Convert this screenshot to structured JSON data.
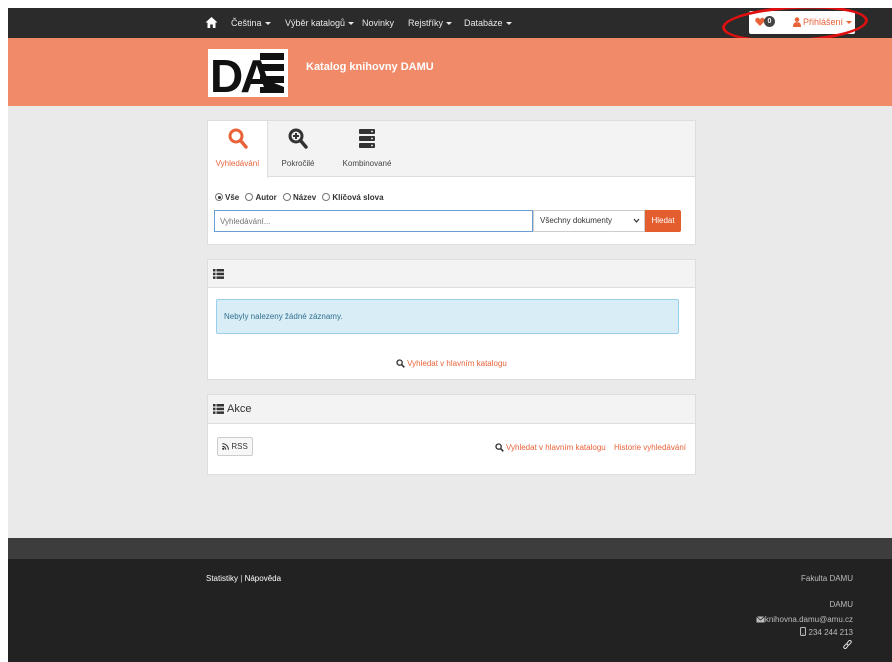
{
  "nav": {
    "items": [
      "Čeština",
      "Výběr katalogů",
      "Novinky",
      "Rejstříky",
      "Databáze"
    ],
    "has_caret": [
      true,
      true,
      false,
      true,
      true
    ],
    "badge_count": "0",
    "login_label": "Přihlášení",
    "annotation_color": "#e01010"
  },
  "header": {
    "logo_letters": "DA",
    "title": "Katalog knihovny DAMU",
    "background": "#f08a68"
  },
  "search": {
    "tabs": [
      "Vyhledávání",
      "Pokročilé",
      "Kombinované"
    ],
    "active_tab": 0,
    "radios": [
      "Vše",
      "Autor",
      "Název",
      "Klíčová slova"
    ],
    "selected_radio": 0,
    "placeholder": "Vyhledávání...",
    "doc_type": "Všechny dokumenty",
    "button_label": "Hledat"
  },
  "results": {
    "empty_message": "Nebyly nalezeny žádné záznamy.",
    "main_catalog_link": "Vyhledat v hlavním katalogu"
  },
  "actions": {
    "title": "Akce",
    "rss_label": "RSS",
    "search_main_link": "Vyhledat v hlavním katalogu",
    "history_link": "Historie vyhledávání"
  },
  "footer": {
    "stats_link": "Statistiky",
    "help_link": "Nápověda",
    "separator": "|",
    "faculty": "Fakulta DAMU",
    "org": "DAMU",
    "email": "knihovna.damu@amu.cz",
    "phone": "234 244 213"
  },
  "colors": {
    "accent": "#e8633a",
    "button": "#e35d2f",
    "nav_bg": "#2b2b2b",
    "footer_bg": "#222222"
  }
}
